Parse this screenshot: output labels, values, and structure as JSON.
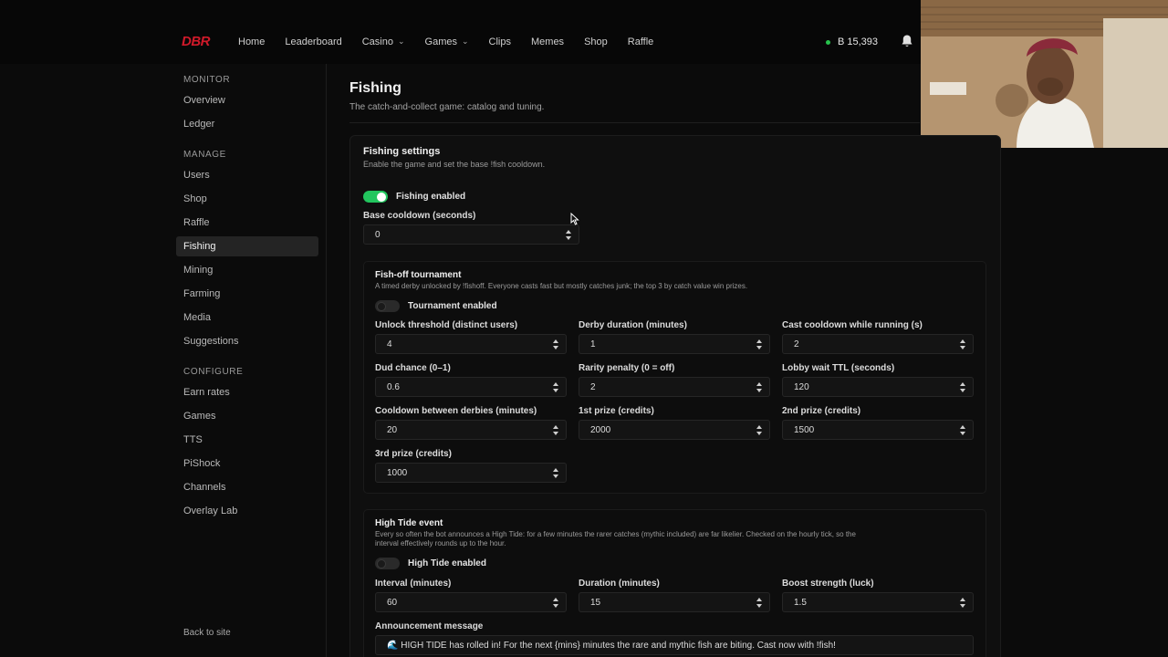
{
  "topbar": {
    "brand": "DBR",
    "nav": [
      {
        "label": "Home",
        "dropdown": false
      },
      {
        "label": "Leaderboard",
        "dropdown": false
      },
      {
        "label": "Casino",
        "dropdown": true
      },
      {
        "label": "Games",
        "dropdown": true
      },
      {
        "label": "Clips",
        "dropdown": false
      },
      {
        "label": "Memes",
        "dropdown": false
      },
      {
        "label": "Shop",
        "dropdown": false
      },
      {
        "label": "Raffle",
        "dropdown": false
      }
    ],
    "balance": "B 15,393",
    "balance_status_color": "#27c24c",
    "notification_icon": "bell-icon"
  },
  "sidebar": {
    "sections": [
      {
        "heading": "MONITOR",
        "items": [
          "Overview",
          "Ledger"
        ]
      },
      {
        "heading": "MANAGE",
        "items": [
          "Users",
          "Shop",
          "Raffle",
          "Fishing",
          "Mining",
          "Farming",
          "Media",
          "Suggestions"
        ]
      },
      {
        "heading": "CONFIGURE",
        "items": [
          "Earn rates",
          "Games",
          "TTS",
          "PiShock",
          "Channels",
          "Overlay Lab"
        ]
      }
    ],
    "active_item": "Fishing",
    "back_link": "Back to site"
  },
  "page": {
    "title": "Fishing",
    "subtitle": "The catch-and-collect game: catalog and tuning."
  },
  "settings": {
    "title": "Fishing settings",
    "subtitle": "Enable the game and set the base !fish cooldown.",
    "enabled_label": "Fishing enabled",
    "enabled": true,
    "cooldown_label": "Base cooldown (seconds)",
    "cooldown_value": "0"
  },
  "tournament": {
    "title": "Fish-off tournament",
    "subtitle": "A timed derby unlocked by !fishoff. Everyone casts fast but mostly catches junk; the top 3 by catch value win prizes.",
    "enabled_label": "Tournament enabled",
    "enabled": false,
    "fields": [
      {
        "label": "Unlock threshold (distinct users)",
        "value": "4"
      },
      {
        "label": "Derby duration (minutes)",
        "value": "1"
      },
      {
        "label": "Cast cooldown while running (s)",
        "value": "2"
      },
      {
        "label": "Dud chance (0–1)",
        "value": "0.6"
      },
      {
        "label": "Rarity penalty (0 = off)",
        "value": "2"
      },
      {
        "label": "Lobby wait TTL (seconds)",
        "value": "120"
      },
      {
        "label": "Cooldown between derbies (minutes)",
        "value": "20"
      },
      {
        "label": "1st prize (credits)",
        "value": "2000"
      },
      {
        "label": "2nd prize (credits)",
        "value": "1500"
      },
      {
        "label": "3rd prize (credits)",
        "value": "1000"
      }
    ]
  },
  "hightide": {
    "title": "High Tide event",
    "subtitle_line1": "Every so often the bot announces a High Tide: for a few minutes the rarer catches (mythic included) are far likelier. Checked on the hourly tick, so the",
    "subtitle_line2": "interval effectively rounds up to the hour.",
    "enabled_label": "High Tide enabled",
    "enabled": false,
    "fields": [
      {
        "label": "Interval (minutes)",
        "value": "60"
      },
      {
        "label": "Duration (minutes)",
        "value": "15"
      },
      {
        "label": "Boost strength (luck)",
        "value": "1.5"
      }
    ],
    "message_label": "Announcement message",
    "message_value": "🌊 HIGH TIDE has rolled in! For the next {mins} minutes the rare and mythic fish are biting. Cast now with !fish!"
  },
  "colors": {
    "accent_green": "#22c55e",
    "brand_red": "#d11a2a"
  }
}
